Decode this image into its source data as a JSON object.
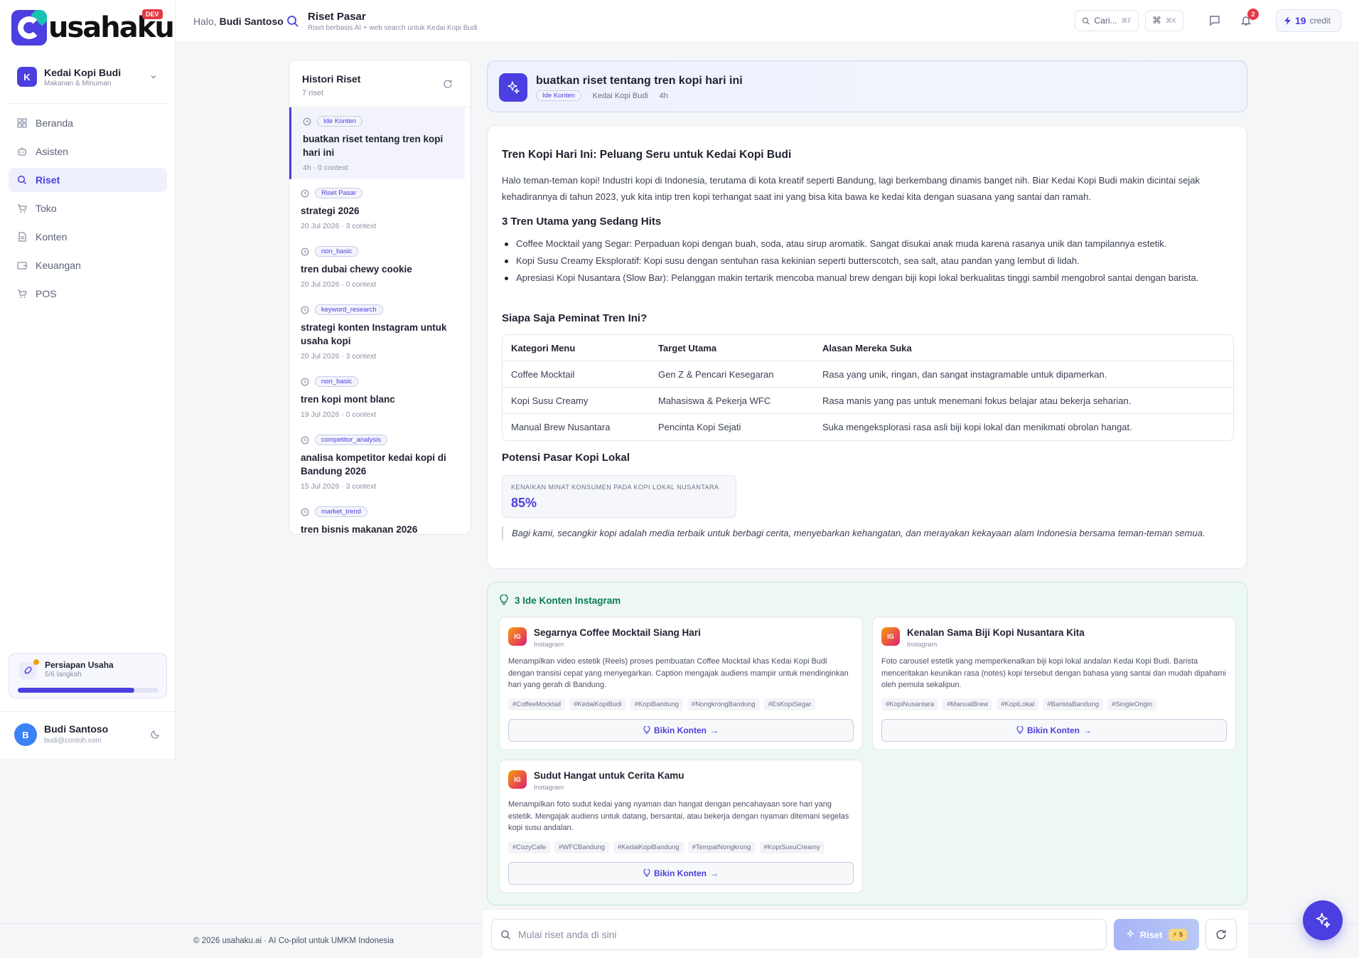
{
  "app": {
    "brand": "usahaku",
    "env_badge": "DEV",
    "accent_color": "#4b3fe0"
  },
  "business": {
    "avatar_letter": "K",
    "name": "Kedai Kopi Budi",
    "category": "Makanan & Minuman"
  },
  "nav": {
    "items": [
      {
        "label": "Beranda",
        "icon": "grid-icon"
      },
      {
        "label": "Asisten",
        "icon": "robot-icon"
      },
      {
        "label": "Riset",
        "icon": "search-icon",
        "active": true
      },
      {
        "label": "Toko",
        "icon": "cart-icon"
      },
      {
        "label": "Konten",
        "icon": "document-icon"
      },
      {
        "label": "Keuangan",
        "icon": "wallet-icon"
      },
      {
        "label": "POS",
        "icon": "cart-icon"
      }
    ]
  },
  "setup": {
    "title": "Persiapan Usaha",
    "progress_text": "5/6 langkah",
    "progress": 0.83
  },
  "user": {
    "avatar_letter": "B",
    "name": "Budi Santoso",
    "email": "budi@contoh.com"
  },
  "header": {
    "greeting_prefix": "Halo,",
    "greeting_name": "Budi Santoso",
    "page_title": "Riset Pasar",
    "page_subtitle": "Riset berbasis AI + web search untuk Kedai Kopi Budi",
    "search_label": "Cari...",
    "search_shortcut": "⌘F",
    "command_shortcut": "⌘K",
    "notification_count": "2",
    "credits_value": "19",
    "credits_label": "credit"
  },
  "history": {
    "title": "Histori Riset",
    "count": "7 riset",
    "items": [
      {
        "tag": "Ide Konten",
        "query": "buatkan riset tentang tren kopi hari ini",
        "meta": "4h · 0 context",
        "active": true
      },
      {
        "tag": "Riset Pasar",
        "query": "strategi 2026",
        "meta": "20 Jul 2026 · 3 context"
      },
      {
        "tag": "non_basic",
        "query": "tren dubai chewy cookie",
        "meta": "20 Jul 2026 · 0 context"
      },
      {
        "tag": "keyword_research",
        "query": "strategi konten Instagram untuk usaha kopi",
        "meta": "20 Jul 2026 · 3 context"
      },
      {
        "tag": "non_basic",
        "query": "tren kopi mont blanc",
        "meta": "19 Jul 2026 · 0 context"
      },
      {
        "tag": "competitor_analysis",
        "query": "analisa kompetitor kedai kopi di Bandung 2026",
        "meta": "15 Jul 2026 · 3 context"
      },
      {
        "tag": "market_trend",
        "query": "tren bisnis makanan 2026",
        "meta": ""
      }
    ]
  },
  "query": {
    "title": "buatkan riset tentang tren kopi hari ini",
    "tag": "Ide Konten",
    "business": "Kedai Kopi Budi",
    "time": "4h"
  },
  "report": {
    "title": "Tren Kopi Hari Ini: Peluang Seru untuk Kedai Kopi Budi",
    "intro": "Halo teman-teman kopi! Industri kopi di Indonesia, terutama di kota kreatif seperti Bandung, lagi berkembang dinamis banget nih. Biar Kedai Kopi Budi makin dicintai sejak kehadirannya di tahun 2023, yuk kita intip tren kopi terhangat saat ini yang bisa kita bawa ke kedai kita dengan suasana yang santai dan ramah.",
    "trends_heading": "3 Tren Utama yang Sedang Hits",
    "trends": [
      "Coffee Mocktail yang Segar: Perpaduan kopi dengan buah, soda, atau sirup aromatik. Sangat disukai anak muda karena rasanya unik dan tampilannya estetik.",
      "Kopi Susu Creamy Eksploratif: Kopi susu dengan sentuhan rasa kekinian seperti butterscotch, sea salt, atau pandan yang lembut di lidah.",
      "Apresiasi Kopi Nusantara (Slow Bar): Pelanggan makin tertarik mencoba manual brew dengan biji kopi lokal berkualitas tinggi sambil mengobrol santai dengan barista."
    ],
    "audience_heading": "Siapa Saja Peminat Tren Ini?",
    "table_headers": [
      "Kategori Menu",
      "Target Utama",
      "Alasan Mereka Suka"
    ],
    "table_rows": [
      [
        "Coffee Mocktail",
        "Gen Z & Pencari Kesegaran",
        "Rasa yang unik, ringan, dan sangat instagramable untuk dipamerkan."
      ],
      [
        "Kopi Susu Creamy",
        "Mahasiswa & Pekerja WFC",
        "Rasa manis yang pas untuk menemani fokus belajar atau bekerja seharian."
      ],
      [
        "Manual Brew Nusantara",
        "Pencinta Kopi Sejati",
        "Suka mengeksplorasi rasa asli biji kopi lokal dan menikmati obrolan hangat."
      ]
    ],
    "market_heading": "Potensi Pasar Kopi Lokal",
    "stat_label": "KENAIKAN MINAT KONSUMEN PADA KOPI LOKAL NUSANTARA",
    "stat_value": "85%",
    "quote": "Bagi kami, secangkir kopi adalah media terbaik untuk berbagi cerita, menyebarkan kehangatan, dan merayakan kekayaan alam Indonesia bersama teman-teman semua."
  },
  "ideas": {
    "heading": "3 Ide Konten Instagram",
    "button_label": "Bikin Konten",
    "items": [
      {
        "badge": "IG",
        "title": "Segarnya Coffee Mocktail Siang Hari",
        "platform": "Instagram",
        "desc": "Menampilkan video estetik (Reels) proses pembuatan Coffee Mocktail khas Kedai Kopi Budi dengan transisi cepat yang menyegarkan. Caption mengajak audiens mampir untuk mendinginkan hari yang gerah di Bandung.",
        "tags": [
          "#CoffeeMocktail",
          "#KedaiKopiBudi",
          "#KopiBandung",
          "#NongkrongBandung",
          "#EsKopiSegar"
        ]
      },
      {
        "badge": "IG",
        "title": "Kenalan Sama Biji Kopi Nusantara Kita",
        "platform": "Instagram",
        "desc": "Foto carousel estetik yang memperkenalkan biji kopi lokal andalan Kedai Kopi Budi. Barista menceritakan keunikan rasa (notes) kopi tersebut dengan bahasa yang santai dan mudah dipahami oleh pemula sekalipun.",
        "tags": [
          "#KopiNusantara",
          "#ManualBrew",
          "#KopiLokal",
          "#BaristaBandung",
          "#SingleOrigin"
        ]
      },
      {
        "badge": "IG",
        "title": "Sudut Hangat untuk Cerita Kamu",
        "platform": "Instagram",
        "desc": "Menampilkan foto sudut kedai yang nyaman dan hangat dengan pencahayaan sore hari yang estetik. Mengajak audiens untuk datang, bersantai, atau bekerja dengan nyaman ditemani segelas kopi susu andalan.",
        "tags": [
          "#CozyCafe",
          "#WFCBandung",
          "#KedaiKopiBandung",
          "#TempatNongkrong",
          "#KopiSusuCreamy"
        ]
      }
    ]
  },
  "input": {
    "placeholder": "Mulai riset anda di sini",
    "submit_label": "Riset",
    "cost": "5"
  },
  "footer": {
    "text": "© 2026 usahaku.ai · AI Co-pilot untuk UMKM Indonesia"
  }
}
